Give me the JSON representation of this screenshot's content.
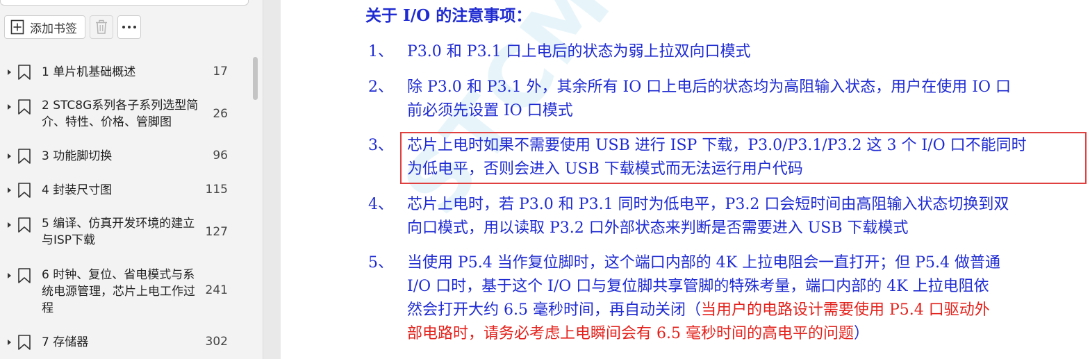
{
  "sidebar": {
    "toolbar": {
      "add_bookmark_label": "添加书签"
    },
    "bookmarks": [
      {
        "title": "1 单片机基础概述",
        "page": "17"
      },
      {
        "title": "2  STC8G系列各子系列选型简介、特性、价格、管脚图",
        "page": "26"
      },
      {
        "title": "3  功能脚切换",
        "page": "96"
      },
      {
        "title": "4  封装尺寸图",
        "page": "115"
      },
      {
        "title": "5  编译、仿真开发环境的建立与ISP下载",
        "page": "127"
      },
      {
        "title": "6  时钟、复位、省电模式与系统电源管理，芯片上电工作过程",
        "page": "241"
      },
      {
        "title": "7  存储器",
        "page": "302"
      }
    ]
  },
  "document": {
    "heading": "关于 I/O 的注意事项：",
    "watermark": "STCMCU",
    "notes": [
      {
        "num": "1、",
        "lines": [
          "P3.0 和 P3.1 口上电后的状态为弱上拉双向口模式"
        ]
      },
      {
        "num": "2、",
        "lines": [
          "除 P3.0 和 P3.1 外，其余所有 IO 口上电后的状态均为高阻输入状态，用户在使用 IO 口",
          "前必须先设置 IO 口模式"
        ]
      },
      {
        "num": "3、",
        "lines": [
          "芯片上电时如果不需要使用 USB 进行 ISP 下载，P3.0/P3.1/P3.2 这 3 个 I/O 口不能同时",
          "为低电平，否则会进入 USB 下载模式而无法运行用户代码"
        ]
      },
      {
        "num": "4、",
        "lines": [
          "芯片上电时，若 P3.0 和 P3.1 同时为低电平，P3.2 口会短时间由高阻输入状态切换到双",
          "向口模式，用以读取 P3.2 口外部状态来判断是否需要进入 USB 下载模式"
        ]
      },
      {
        "num": "5、",
        "lines": [
          "当使用 P5.4 当作复位脚时，这个端口内部的 4K 上拉电阻会一直打开；但 P5.4 做普通",
          "I/O 口时，基于这个 I/O 口与复位脚共享管脚的特殊考量，端口内部的 4K 上拉电阻依"
        ],
        "line3_blue": "然会打开大约 6.5 毫秒时间，再自动关闭（",
        "line3_red": "当用户的电路设计需要使用 P5.4 口驱动外",
        "line4_red": "部电路时，请务必考虑上电瞬间会有 6.5 毫秒时间的高电平的问题",
        "line4_blue": "）"
      }
    ]
  }
}
